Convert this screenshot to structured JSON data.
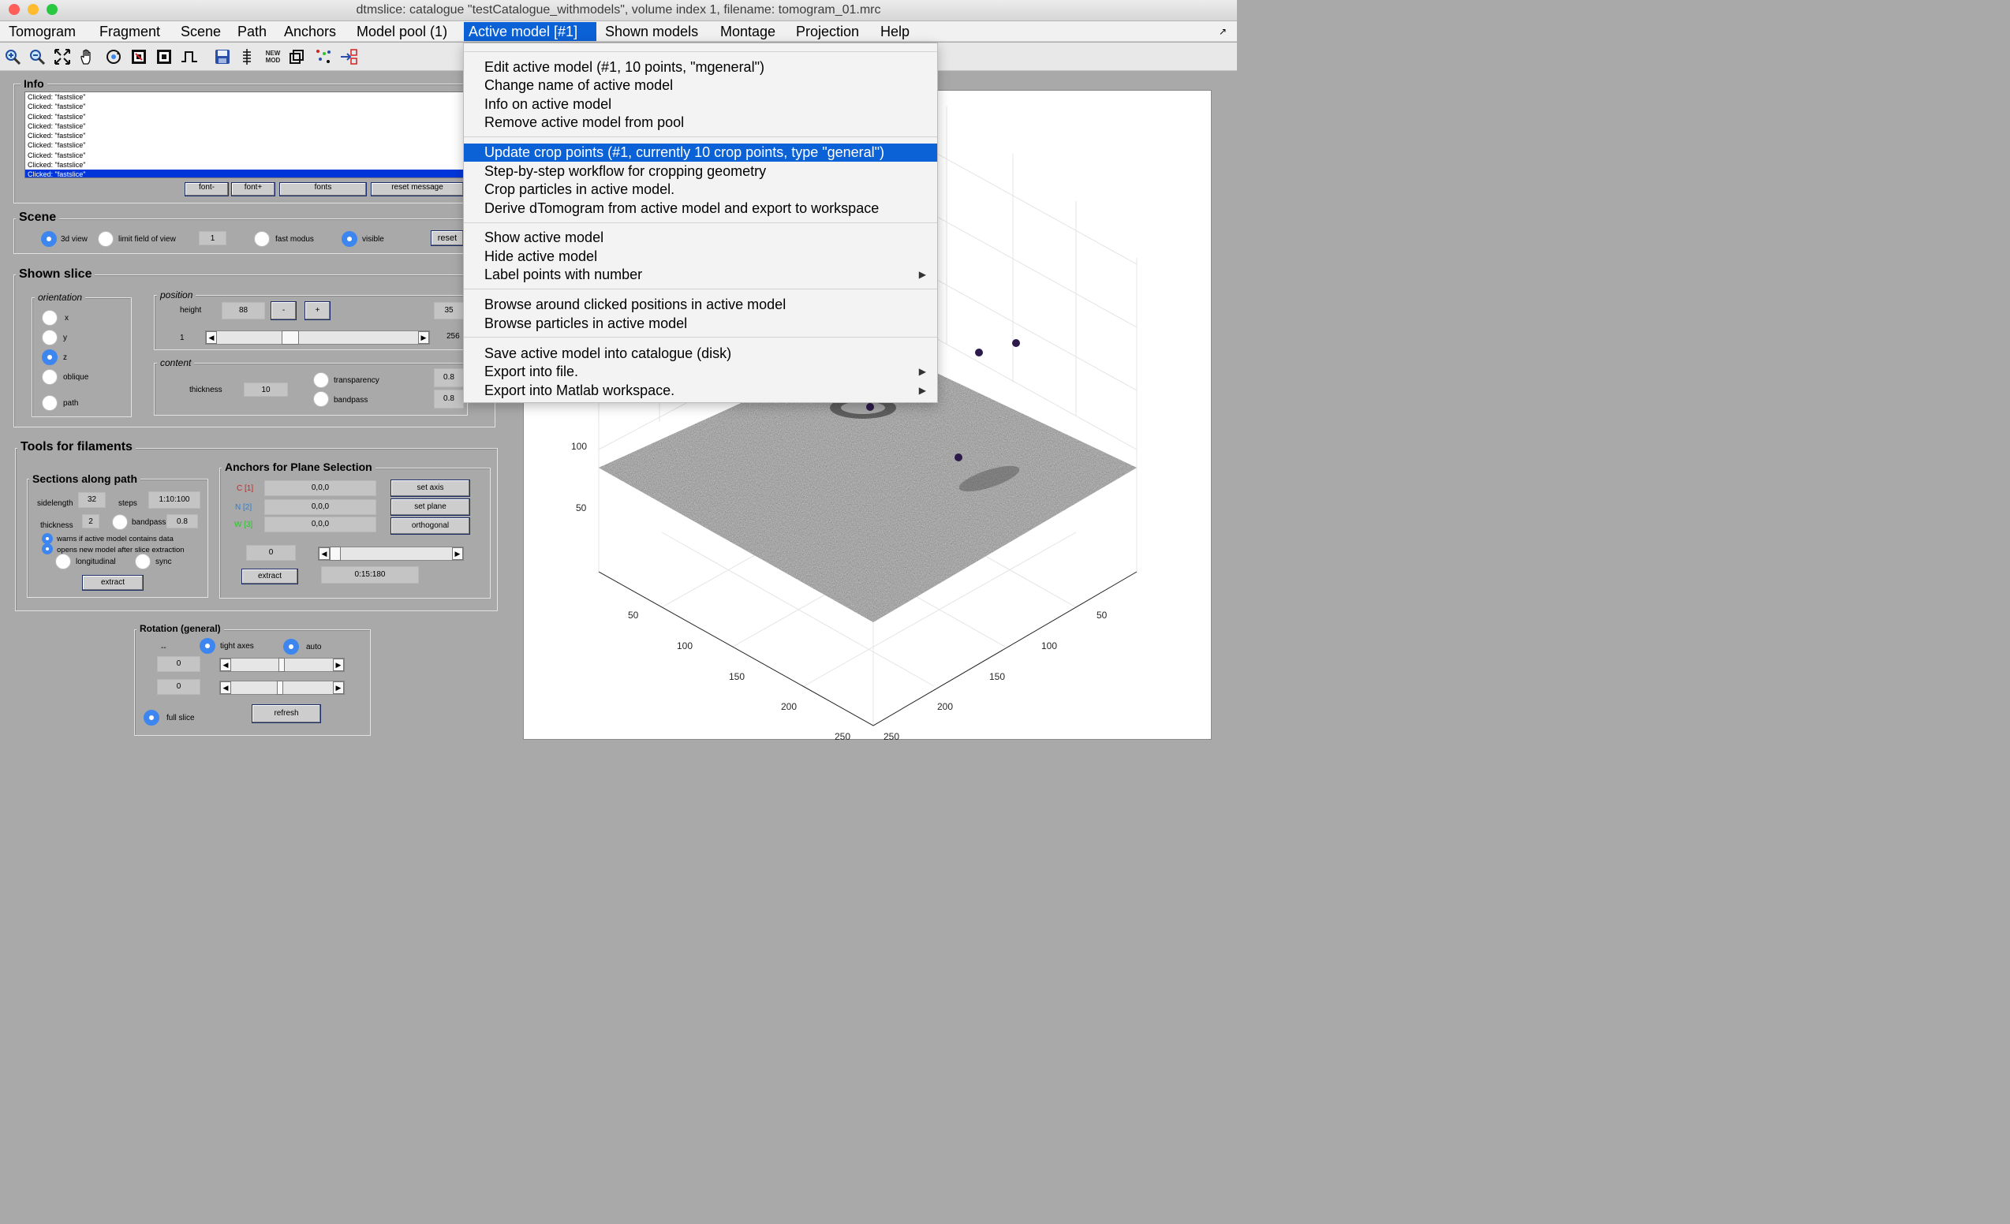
{
  "window": {
    "title": "dtmslice: catalogue \"testCatalogue_withmodels\", volume index 1, filename: tomogram_01.mrc"
  },
  "menubar": {
    "items": [
      "Tomogram",
      "Fragment",
      "Scene",
      "Path",
      "Anchors",
      "Model pool (1)",
      "Active model [#1]",
      "Shown models",
      "Montage",
      "Projection",
      "Help"
    ],
    "right_arrow": "↗"
  },
  "toolbar": {
    "icons": [
      "zoom-in-icon",
      "zoom-out-icon",
      "fit-icon",
      "pan-hand-icon",
      "rotate-3d-icon",
      "contrast-icon",
      "contrast-alt-icon",
      "step-function-icon",
      "save-icon",
      "slice-icon",
      "new-model-icon",
      "cube-icon",
      "points-icon",
      "export-icon"
    ],
    "new_mod_label": "NEW MOD"
  },
  "info": {
    "title": "Info",
    "log": [
      "Clicked: \"fastslice\"",
      "Clicked: \"fastslice\"",
      "Clicked: \"fastslice\"",
      "Clicked: \"fastslice\"",
      "Clicked: \"fastslice\"",
      "Clicked: \"fastslice\"",
      "Clicked: \"fastslice\"",
      "Clicked: \"fastslice\"",
      "Clicked: \"fastslice\""
    ],
    "font_minus": "font-",
    "font_plus": "font+",
    "fonts": "fonts",
    "reset_message": "reset message"
  },
  "scene": {
    "title": "Scene",
    "view3d": "3d view",
    "limit": "limit field of view",
    "limit_value": "1",
    "fast": "fast modus",
    "visible": "visible",
    "reset": "reset"
  },
  "shown_slice": {
    "title": "Shown slice",
    "orientation": {
      "title": "orientation",
      "x": "x",
      "y": "y",
      "z": "z",
      "oblique": "oblique",
      "path": "path"
    },
    "position": {
      "title": "position",
      "height_label": "height",
      "height_value": "88",
      "minus": "-",
      "plus": "+",
      "max_field": "35",
      "slider_min": "1",
      "slider_max": "256"
    },
    "content": {
      "title": "content",
      "thickness_label": "thickness",
      "thickness_value": "10",
      "transparency": "transparency",
      "transparency_value": "0.8",
      "bandpass": "bandpass",
      "bandpass_value": "0.8"
    }
  },
  "filaments": {
    "title": "Tools for filaments",
    "sections": {
      "title": "Sections along path",
      "sidelength_label": "sidelength",
      "sidelength": "32",
      "steps_label": "steps",
      "steps": "1:10:100",
      "thickness_label": "thickness",
      "thickness": "2",
      "bandpass_label": "bandpass",
      "bandpass": "0.8",
      "warns": "warns if active model contains data",
      "opens": "opens new model after slice extraction",
      "longitudinal": "longitudinal",
      "sync": "sync",
      "extract": "extract"
    },
    "anchors": {
      "title": "Anchors for Plane Selection",
      "c_label": "C [1]",
      "n_label": "N [2]",
      "w_label": "W [3]",
      "c_value": "0,0,0",
      "n_value": "0,0,0",
      "w_value": "0,0,0",
      "set_axis": "set axis",
      "set_plane": "set plane",
      "orthogonal": "orthogonal",
      "index": "0",
      "extract": "extract",
      "range": "0:15:180",
      "c_color": "#d42020",
      "n_color": "#2a7fd4",
      "w_color": "#2bc42b"
    }
  },
  "rotation": {
    "title": "Rotation (general)",
    "dashes": "--",
    "tight_axes": "tight axes",
    "auto": "auto",
    "val1": "0",
    "val2": "0",
    "full_slice": "full slice",
    "refresh": "refresh"
  },
  "plot": {
    "ticks_z": [
      "100",
      "50"
    ],
    "ticks_left": [
      "50",
      "100",
      "150",
      "200",
      "250"
    ],
    "ticks_right": [
      "50",
      "100",
      "150",
      "200",
      "250"
    ]
  },
  "dropdown": {
    "groups": [
      [
        "Edit active model (#1, 10 points, \"mgeneral\")",
        "Change name of active model",
        "Info on active model",
        "Remove active model from pool"
      ],
      [
        "Update crop points (#1, currently 10 crop points, type \"general\")",
        "Step-by-step workflow for cropping geometry",
        "Crop particles in active model.",
        "Derive dTomogram from active model and export to workspace"
      ],
      [
        "Show active model",
        "Hide active model",
        "Label points with number"
      ],
      [
        "Browse around clicked positions in active model",
        "Browse particles in active model"
      ],
      [
        "Save active model into catalogue (disk)",
        "Export into file.",
        "Export into Matlab workspace."
      ]
    ],
    "submenu_arrow": "▶"
  },
  "colors": {
    "accent": "#0b61d6",
    "radio_on": "#3d86f0",
    "point": "#2b1a4a"
  }
}
